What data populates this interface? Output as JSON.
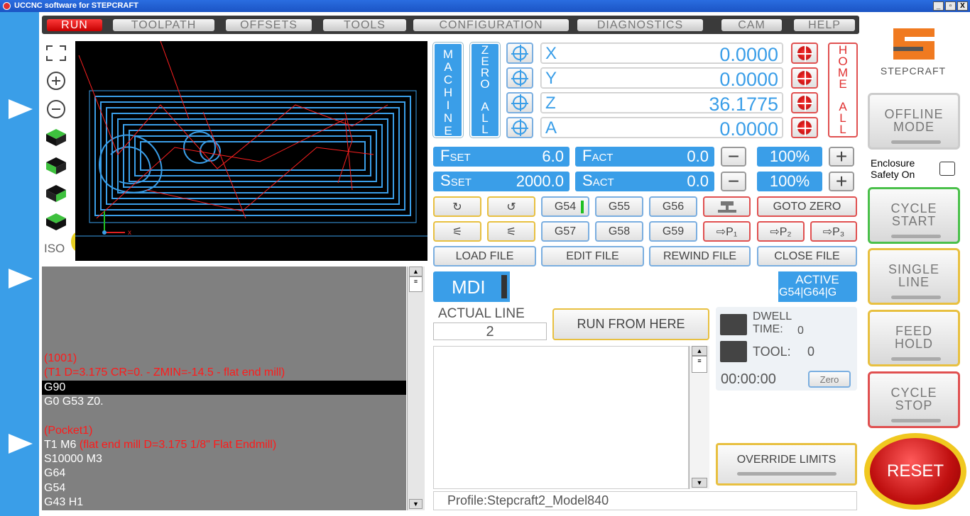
{
  "window": {
    "title": "UCCNC software for STEPCRAFT",
    "min": "_",
    "restore": "▫",
    "close": "X"
  },
  "tabs": [
    "RUN",
    "TOOLPATH",
    "OFFSETS",
    "TOOLS",
    "CONFIGURATION",
    "DIAGNOSTICS",
    "CAM",
    "HELP"
  ],
  "view": {
    "iso_label": "ISO",
    "axis_x": "x"
  },
  "dro": {
    "machine_label": [
      "M",
      "A",
      "C",
      "H",
      "I",
      "N",
      "E"
    ],
    "zero_all_label": [
      "Z",
      "E",
      "R",
      "O",
      "",
      "A",
      "L",
      "L"
    ],
    "home_all_label": [
      "H",
      "O",
      "M",
      "E",
      "",
      "A",
      "L",
      "L"
    ],
    "axes": [
      {
        "name": "X",
        "value": "0.0000"
      },
      {
        "name": "Y",
        "value": "0.0000"
      },
      {
        "name": "Z",
        "value": "36.1775"
      },
      {
        "name": "A",
        "value": "0.0000"
      }
    ]
  },
  "feeds": {
    "fset_label": "F",
    "fset_sub": "SET",
    "fset_value": "6.0",
    "fact_label": "F",
    "fact_sub": "ACT",
    "fact_value": "0.0",
    "sset_label": "S",
    "sset_sub": "SET",
    "sset_value": "2000.0",
    "sact_label": "S",
    "sact_sub": "ACT",
    "sact_value": "0.0",
    "feed_override": "100%",
    "spindle_override": "100%",
    "minus": "−",
    "plus": "+"
  },
  "buttons": {
    "g54": "G54",
    "g55": "G55",
    "g56": "G56",
    "g57": "G57",
    "g58": "G58",
    "g59": "G59",
    "goto_zero": "GOTO ZERO",
    "p1": "⇨P₁",
    "p2": "⇨P₂",
    "p3": "⇨P₃",
    "load_file": "LOAD FILE",
    "edit_file": "EDIT FILE",
    "rewind_file": "REWIND FILE",
    "close_file": "CLOSE FILE",
    "run_from_here": "RUN FROM HERE",
    "override_limits": "OVERRIDE LIMITS",
    "zero": "Zero"
  },
  "mdi": {
    "label": "MDI",
    "active_label": "ACTIVE",
    "active_codes": "G54|G64|G"
  },
  "actual_line": {
    "label": "ACTUAL LINE",
    "value": "2"
  },
  "status": {
    "dwell_label": "DWELL",
    "time_label": "TIME:",
    "time_value": "0",
    "tool_label": "TOOL:",
    "tool_value": "0",
    "timer": "00:00:00"
  },
  "profile": "Profile:Stepcraft2_Model840",
  "gcode_lines": [
    {
      "text": "(1001)",
      "color": "red"
    },
    {
      "text": "(T1  D=3.175 CR=0. - ZMIN=-14.5 - flat end mill)",
      "color": "red"
    },
    {
      "text": "G90",
      "color": "white",
      "selected": true
    },
    {
      "text": "G0 G53 Z0.",
      "color": "white"
    },
    {
      "text": "",
      "color": "white"
    },
    {
      "text": "(Pocket1)",
      "color": "red"
    },
    {
      "text": "T1 M6 ",
      "color": "white",
      "tail": "(flat end mill D=3.175 1/8\" Flat Endmill)"
    },
    {
      "text": "S10000 M3",
      "color": "white"
    },
    {
      "text": "G64",
      "color": "white"
    },
    {
      "text": "G54",
      "color": "white"
    },
    {
      "text": "G43 H1",
      "color": "white"
    }
  ],
  "right": {
    "brand": "STEPCRAFT",
    "offline": [
      "OFFLINE",
      "MODE"
    ],
    "enclosure": [
      "Enclosure",
      "Safety On"
    ],
    "cycle_start": [
      "CYCLE",
      "START"
    ],
    "single_line": [
      "SINGLE",
      "LINE"
    ],
    "feed_hold": [
      "FEED",
      "HOLD"
    ],
    "cycle_stop": [
      "CYCLE",
      "STOP"
    ],
    "reset": "RESET"
  },
  "colors": {
    "accent": "#3a9ee8",
    "tab_active": "#e00000",
    "reset": "#d01818"
  }
}
